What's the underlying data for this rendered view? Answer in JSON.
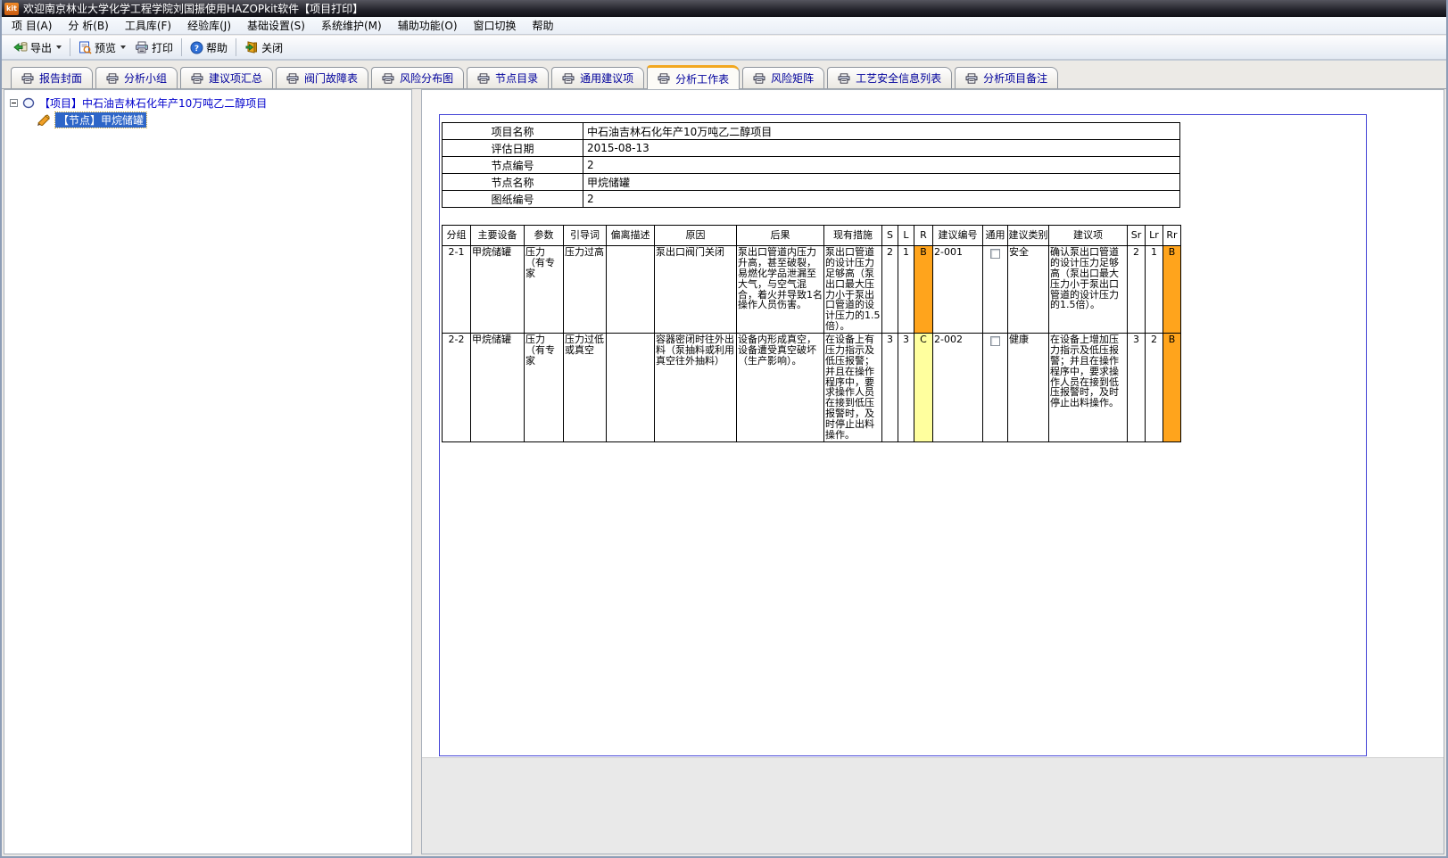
{
  "window": {
    "icon_text": "kit",
    "title": "欢迎南京林业大学化学工程学院刘国振使用HAZOPkit软件【项目打印】"
  },
  "menu": {
    "items": [
      "项 目(A)",
      "分 析(B)",
      "工具库(F)",
      "经验库(J)",
      "基础设置(S)",
      "系统维护(M)",
      "辅助功能(O)",
      "窗口切换",
      "帮助"
    ]
  },
  "toolbar": {
    "export_label": "导出",
    "preview_label": "预览",
    "print_label": "打印",
    "help_label": "帮助",
    "close_label": "关闭"
  },
  "tabs": {
    "active": "分析工作表",
    "items": [
      "报告封面",
      "分析小组",
      "建议项汇总",
      "阀门故障表",
      "风险分布图",
      "节点目录",
      "通用建议项",
      "分析工作表",
      "风险矩阵",
      "工艺安全信息列表",
      "分析项目备注"
    ]
  },
  "tree": {
    "root_label": "【项目】中石油吉林石化年产10万吨乙二醇项目",
    "node_label": "【节点】甲烷储罐"
  },
  "info": {
    "rows": [
      {
        "label": "项目名称",
        "value": "中石油吉林石化年产10万吨乙二醇项目"
      },
      {
        "label": "评估日期",
        "value": "2015-08-13"
      },
      {
        "label": "节点编号",
        "value": "2"
      },
      {
        "label": "节点名称",
        "value": "甲烷储罐"
      },
      {
        "label": "图纸编号",
        "value": "2"
      }
    ]
  },
  "worksheet": {
    "headers": [
      "分组",
      "主要设备",
      "参数",
      "引导词",
      "偏离描述",
      "原因",
      "后果",
      "现有措施",
      "S",
      "L",
      "R",
      "建议编号",
      "通用",
      "建议类别",
      "建议项",
      "Sr",
      "Lr",
      "Rr"
    ],
    "rows": [
      {
        "group": "2-1",
        "equipment": "甲烷储罐",
        "parameter": "压力（有专家",
        "guideword": "压力过高",
        "deviation": "",
        "cause": "泵出口阀门关闭",
        "consequence": "泵出口管道内压力升高，甚至破裂，易燃化学品泄漏至大气，与空气混合，着火并导致1名操作人员伤害。",
        "safeguards": "泵出口管道的设计压力足够高（泵出口最大压力小于泵出口管道的设计压力的1.5倍）。",
        "s": "2",
        "l": "1",
        "r": "B",
        "r_color": "#FFA41C",
        "rec_no": "2-001",
        "common_checked": false,
        "rec_type": "安全",
        "recommendation": "确认泵出口管道的设计压力足够高（泵出口最大压力小于泵出口管道的设计压力的1.5倍）。",
        "sr": "2",
        "lr": "1",
        "rr": "B",
        "rr_color": "#FFA41C"
      },
      {
        "group": "2-2",
        "equipment": "甲烷储罐",
        "parameter": "压力（有专家",
        "guideword": "压力过低或真空",
        "deviation": "",
        "cause": "容器密闭时往外出料（泵抽料或利用真空往外抽料）",
        "consequence": "设备内形成真空，设备遭受真空破坏（生产影响）。",
        "safeguards": "在设备上有压力指示及低压报警；并且在操作程序中，要求操作人员在接到低压报警时，及时停止出料操作。",
        "s": "3",
        "l": "3",
        "r": "C",
        "r_color": "#FFFF9E",
        "rec_no": "2-002",
        "common_checked": false,
        "rec_type": "健康",
        "recommendation": "在设备上增加压力指示及低压报警；并且在操作程序中，要求操作人员在接到低压报警时，及时停止出料操作。",
        "sr": "3",
        "lr": "2",
        "rr": "B",
        "rr_color": "#FFA41C"
      }
    ]
  },
  "colors": {
    "risk_b_orange": "#FFA41C",
    "risk_c_yellow": "#FFFF9E",
    "tab_active_accent": "#F2A71E",
    "tree_selection_blue": "#2E66C8",
    "tree_root_text": "#0000CC",
    "tab_text_navy": "#00009C",
    "page_border_blue": "#4343D6"
  }
}
